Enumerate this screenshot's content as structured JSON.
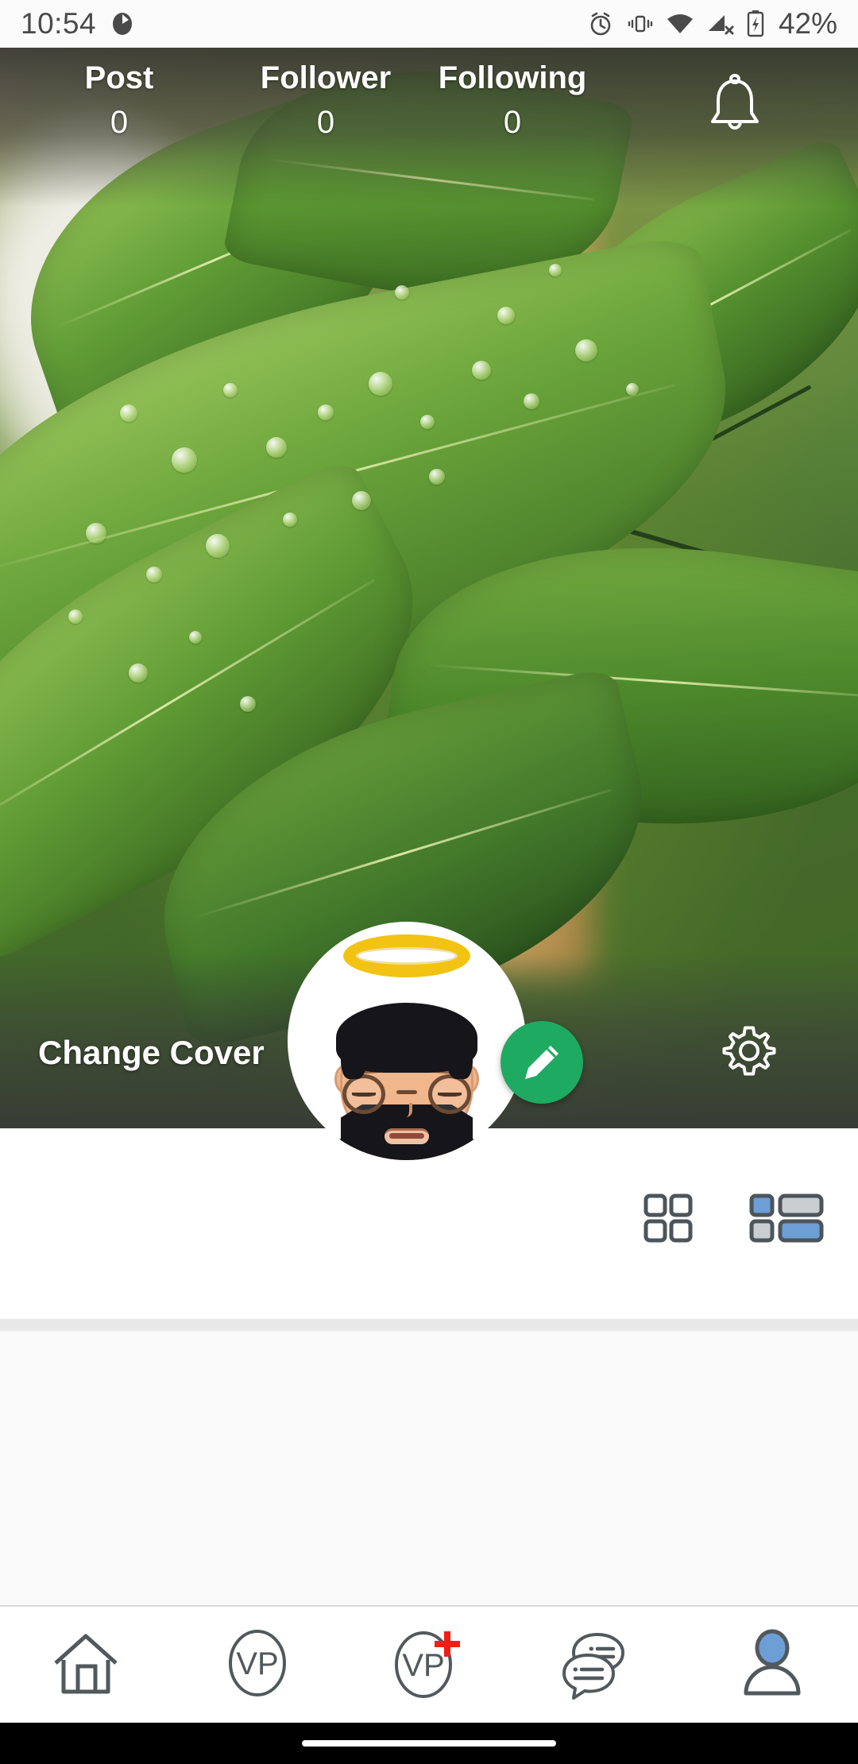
{
  "status_bar": {
    "time": "10:54",
    "battery_percent": "42%",
    "icons": [
      "location-icon",
      "alarm-icon",
      "vibrate-icon",
      "wifi-icon",
      "signal-off-icon",
      "battery-charging-icon"
    ]
  },
  "profile_header": {
    "stats": [
      {
        "label": "Post",
        "value": "0"
      },
      {
        "label": "Follower",
        "value": "0"
      },
      {
        "label": "Following",
        "value": "0"
      }
    ],
    "notification_icon": "bell-icon",
    "change_cover_label": "Change Cover",
    "settings_icon": "gear-icon",
    "edit_profile_icon": "pencil-icon",
    "avatar_icon": "user-avatar-halo-icon"
  },
  "view_toggles": [
    {
      "name": "grid-view",
      "icon": "grid-icon",
      "selected": false
    },
    {
      "name": "list-view",
      "icon": "list-icon",
      "selected": true
    }
  ],
  "bottom_nav": [
    {
      "name": "home",
      "icon": "home-icon",
      "label": "",
      "active": false
    },
    {
      "name": "vp",
      "icon": "vp-circle-icon",
      "label": "VP",
      "active": false
    },
    {
      "name": "vp-add",
      "icon": "vp-circle-plus-icon",
      "label": "VP",
      "badge": "+",
      "active": false
    },
    {
      "name": "chat",
      "icon": "chat-bubbles-icon",
      "label": "",
      "active": false
    },
    {
      "name": "profile",
      "icon": "person-icon",
      "label": "",
      "active": true
    }
  ],
  "colors": {
    "accent_green": "#1faa62",
    "accent_blue": "#6d9ed6",
    "icon_gray": "#51595c",
    "badge_red": "#ee2016",
    "halo_gold": "#f2c313",
    "status_text": "#4a4a4a"
  }
}
